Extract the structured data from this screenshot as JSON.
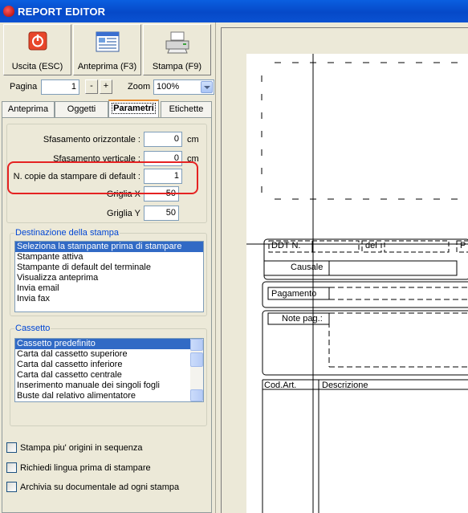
{
  "window": {
    "title": "REPORT EDITOR"
  },
  "toolbar": {
    "exit_label": "Uscita (ESC)",
    "preview_label": "Anteprima (F3)",
    "print_label": "Stampa (F9)"
  },
  "pagination": {
    "page_label": "Pagina",
    "page_value": "1",
    "minus_label": "-",
    "plus_label": "+",
    "zoom_label": "Zoom",
    "zoom_value": "100%"
  },
  "tabs": [
    {
      "label": "Anteprima"
    },
    {
      "label": "Oggetti"
    },
    {
      "label": "Parametri"
    },
    {
      "label": "Etichette"
    }
  ],
  "params": {
    "horizontal_offset_label": "Sfasamento orizzontale :",
    "horizontal_offset_value": "0",
    "vertical_offset_label": "Sfasamento verticale :",
    "vertical_offset_value": "0",
    "unit_cm": "cm",
    "copies_label": "N. copie da stampare di default :",
    "copies_value": "1",
    "grid_x_label": "Griglia X",
    "grid_x_value": "50",
    "grid_y_label": "Griglia Y",
    "grid_y_value": "50"
  },
  "destination": {
    "title": "Destinazione della stampa",
    "items": [
      "Seleziona la stampante prima di stampare",
      "Stampante attiva",
      "Stampante di default del terminale",
      "Visualizza anteprima",
      "Invia email",
      "Invia fax"
    ],
    "selected_index": 0
  },
  "tray": {
    "title": "Cassetto",
    "items": [
      "Cassetto predefinito",
      "Carta dal cassetto superiore",
      "Carta dal cassetto inferiore",
      "Carta dal cassetto centrale",
      "Inserimento manuale dei singoli fogli",
      "Buste dal relativo alimentatore"
    ],
    "selected_index": 0
  },
  "options": [
    {
      "label": "Stampa piu' origini in sequenza",
      "checked": false
    },
    {
      "label": "Richiedi lingua prima di stampare",
      "checked": false
    },
    {
      "label": "Archivia su documentale ad ogni stampa",
      "checked": false
    }
  ],
  "report": {
    "ddt_label": "DDT N.",
    "del_label": "del",
    "p_label": "P",
    "causale_label": "Causale",
    "pagamento_label": "Pagamento",
    "note_label": "Note pag.:",
    "cod_art_label": "Cod.Art.",
    "descrizione_label": "Descrizione"
  },
  "colors": {
    "titlebar": "#0A52D2",
    "selection": "#316AC5",
    "highlight": "#E52222",
    "group_title": "#0046D5"
  }
}
